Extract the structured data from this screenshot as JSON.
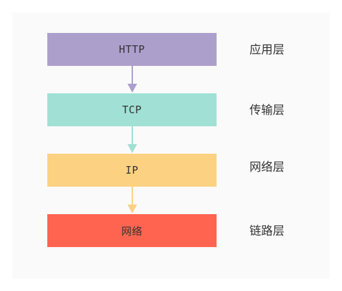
{
  "layers": [
    {
      "box_text": "HTTP",
      "label": "应用层",
      "color": "#ad9fcc"
    },
    {
      "box_text": "TCP",
      "label": "传输层",
      "color": "#a0e0d5"
    },
    {
      "box_text": "IP",
      "label": "网络层",
      "color": "#fdd182"
    },
    {
      "box_text": "网络",
      "label": "链路层",
      "color": "#ff6450"
    }
  ]
}
